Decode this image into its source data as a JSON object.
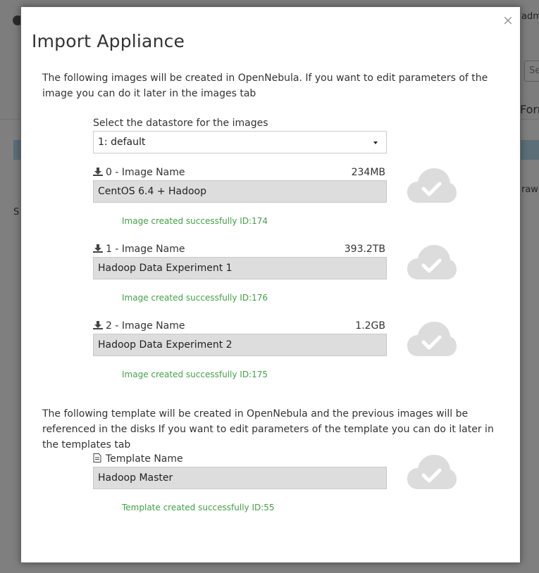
{
  "background": {
    "user_fragment": "adm",
    "search_fragment": "Se",
    "form_fragment": "Forr",
    "raw_fragment": "raw",
    "side_fragment": "S"
  },
  "modal": {
    "title": "Import Appliance",
    "close_label": "×",
    "images_intro": "The following images will be created in OpenNebula. If you want to edit parameters of the image you can do it later in the images tab",
    "datastore_label": "Select the datastore for the images",
    "datastore_value": "1: default",
    "images": [
      {
        "label": "0 - Image Name",
        "size": "234MB",
        "name": "CentOS 6.4 + Hadoop",
        "status": "Image created successfully ID:174"
      },
      {
        "label": "1 - Image Name",
        "size": "393.2TB",
        "name": "Hadoop Data Experiment 1",
        "status": "Image created successfully ID:176"
      },
      {
        "label": "2 - Image Name",
        "size": "1.2GB",
        "name": "Hadoop Data Experiment 2",
        "status": "Image created successfully ID:175"
      }
    ],
    "template_intro": "The following template will be created in OpenNebula and the previous images will be referenced in the disks If you want to edit parameters of the template you can do it later in the templates tab",
    "template": {
      "label": "Template Name",
      "name": "Hadoop Master",
      "status": "Template created successfully ID:55"
    }
  },
  "icons": {
    "download": "download-icon",
    "document": "document-icon",
    "cloud_check": "cloud-check-icon"
  },
  "colors": {
    "success_text": "#43a047",
    "cloud_icon": "#dcdcdc",
    "field_bg": "#dddddd"
  }
}
